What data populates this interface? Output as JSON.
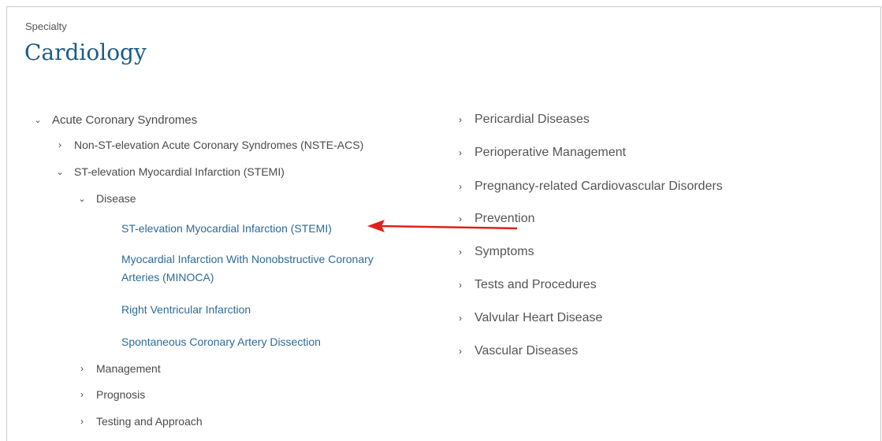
{
  "header": {
    "specialty_label": "Specialty",
    "title": "Cardiology"
  },
  "left_tree": {
    "acs": {
      "label": "Acute Coronary Syndromes",
      "icon": "chevron-down-icon"
    },
    "nste_acs": {
      "label": "Non-ST-elevation Acute Coronary Syndromes (NSTE-ACS)",
      "icon": "chevron-right-icon"
    },
    "stemi": {
      "label": "ST-elevation Myocardial Infarction (STEMI)",
      "icon": "chevron-down-icon"
    },
    "disease": {
      "label": "Disease",
      "icon": "chevron-down-icon"
    },
    "disease_links": [
      "ST-elevation Myocardial Infarction (STEMI)",
      "Myocardial Infarction With Nonobstructive Coronary",
      "Arteries (MINOCA)",
      "Right Ventricular Infarction",
      "Spontaneous Coronary Artery Dissection"
    ],
    "management": {
      "label": "Management",
      "icon": "chevron-right-icon"
    },
    "prognosis": {
      "label": "Prognosis",
      "icon": "chevron-right-icon"
    },
    "testing": {
      "label": "Testing and Approach",
      "icon": "chevron-right-icon"
    }
  },
  "right_list": [
    "Pericardial Diseases",
    "Perioperative Management",
    "Pregnancy-related Cardiovascular Disorders",
    "Prevention",
    "Symptoms",
    "Tests and Procedures",
    "Valvular Heart Disease",
    "Vascular Diseases"
  ],
  "glyphs": {
    "chevron_right": "›",
    "chevron_down": "⌄"
  },
  "colors": {
    "title": "#1e5b86",
    "link": "#2d6a97",
    "annotation_arrow": "#e0201c"
  }
}
